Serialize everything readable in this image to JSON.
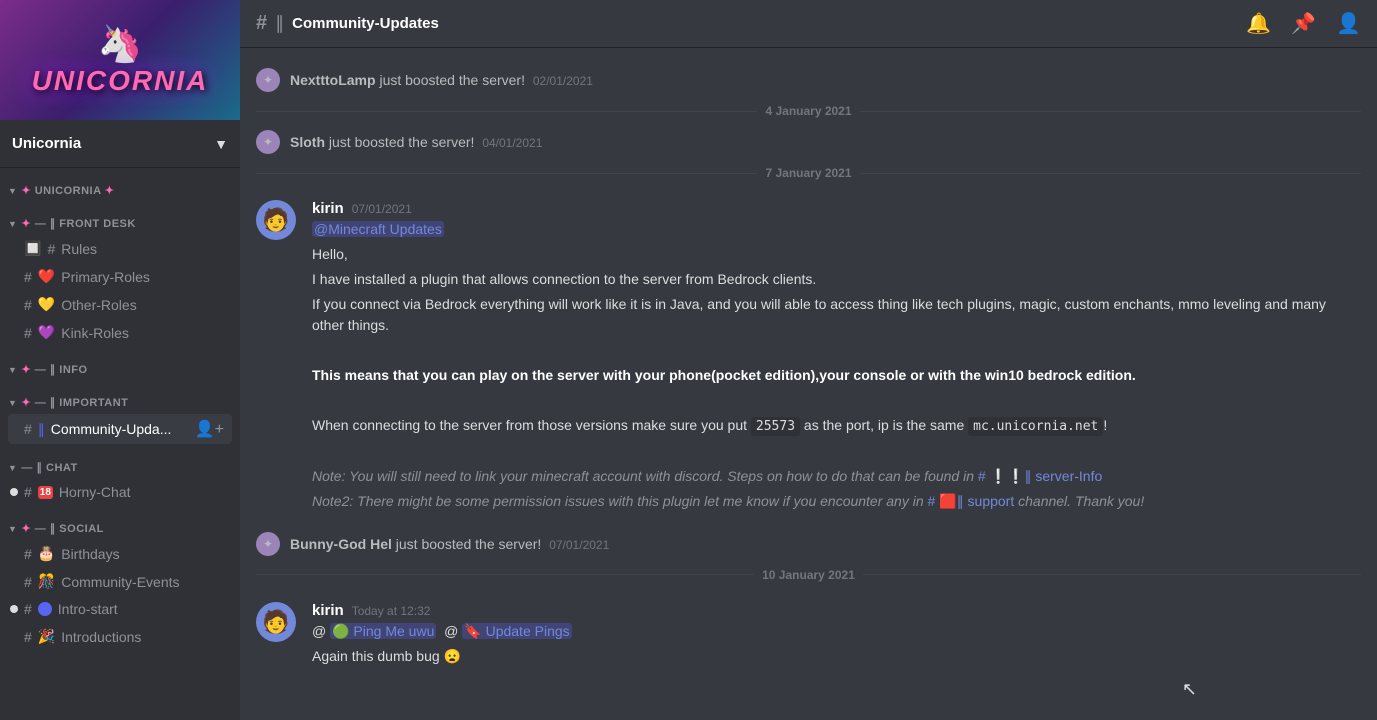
{
  "server": {
    "name": "Unicornia",
    "banner_text": "UNICORNIA",
    "dropdown_arrow": "▼"
  },
  "categories": [
    {
      "id": "unicornia",
      "label": "✦ UNICORNIA ✦",
      "channels": []
    },
    {
      "id": "front-desk",
      "label": "✦ — ∥ FRONT DESK",
      "channels": [
        {
          "id": "rules",
          "name": "Rules",
          "icon": "#",
          "emoji": "🔲",
          "emoji_color": "#ed4245"
        },
        {
          "id": "primary-roles",
          "name": "Primary-Roles",
          "icon": "#",
          "emoji": "❤️"
        },
        {
          "id": "other-roles",
          "name": "Other-Roles",
          "icon": "#",
          "emoji": "💛"
        },
        {
          "id": "kink-roles",
          "name": "Kink-Roles",
          "icon": "#",
          "emoji": "💜"
        }
      ]
    },
    {
      "id": "info",
      "label": "✦ — ∥ INFO",
      "channels": []
    },
    {
      "id": "important",
      "label": "✦ — ∥ IMPORTANT",
      "channels": [
        {
          "id": "community-updates",
          "name": "Community-Upda...",
          "icon": "#",
          "emoji": "∥",
          "active": true,
          "has_add": true
        }
      ]
    },
    {
      "id": "chat",
      "label": "— ∥ CHAT",
      "channels": [
        {
          "id": "horny-chat",
          "name": "Horny-Chat",
          "icon": "#",
          "emoji": "🔞",
          "has_unread": true
        }
      ]
    },
    {
      "id": "social",
      "label": "✦ — ∥ SOCIAL",
      "channels": [
        {
          "id": "birthdays",
          "name": "Birthdays",
          "icon": "#",
          "emoji": "🎂"
        },
        {
          "id": "community-events",
          "name": "Community-Events",
          "icon": "#",
          "emoji": "🎊"
        },
        {
          "id": "intro-start",
          "name": "Intro-start",
          "icon": "#",
          "emoji": "🔵",
          "has_unread": true
        },
        {
          "id": "introductions",
          "name": "Introductions",
          "icon": "#",
          "emoji": "🎉"
        }
      ]
    }
  ],
  "channel": {
    "name": "Community-Updates",
    "icon": "∥",
    "hash": "#"
  },
  "header_icons": {
    "bell": "🔔",
    "pin": "📌",
    "members": "👤"
  },
  "messages": [
    {
      "type": "boost",
      "user": "NextttoLamp",
      "text": "just boosted the server!",
      "date": "02/01/2021"
    },
    {
      "type": "date_divider",
      "label": "4 January 2021"
    },
    {
      "type": "boost",
      "user": "Sloth",
      "text": "just boosted the server!",
      "date": "04/01/2021"
    },
    {
      "type": "date_divider",
      "label": "7 January 2021"
    },
    {
      "type": "message",
      "id": "msg1",
      "author": "kirin",
      "timestamp": "07/01/2021",
      "avatar_color": "#5865f2",
      "avatar_emoji": "🧑",
      "lines": [
        {
          "type": "mention",
          "text": "@Minecraft Updates"
        },
        {
          "type": "plain",
          "text": "Hello,"
        },
        {
          "type": "plain",
          "text": "I have installed a plugin that allows connection to the server from Bedrock clients."
        },
        {
          "type": "plain",
          "text": "If you connect via Bedrock everything will work like it is in Java, and you will able to access thing like tech plugins, magic, custom enchants, mmo leveling and many other things."
        },
        {
          "type": "bold",
          "text": "This means that you can play on the server with your phone(pocket edition),your console or with the win10 bedrock edition."
        },
        {
          "type": "plain",
          "text": "When connecting to the server from those versions make sure you put "
        },
        {
          "type": "port_info",
          "port": "25573",
          "suffix": " as the port, ip is the same ",
          "code": "mc.unicornia.net",
          "end": "!"
        },
        {
          "type": "italic_note",
          "text": "Note: You will still need to link your minecraft account with discord. Steps on how to do that can be found in # ❕❕∥ server-Info"
        },
        {
          "type": "italic_note2",
          "text": "Note2: There might be some permission issues with this plugin let me know if you encounter any in # 🟥∥ support channel. Thank you!"
        }
      ]
    },
    {
      "type": "boost",
      "user": "Bunny-God Hel",
      "text": "just boosted the server!",
      "date": "07/01/2021"
    },
    {
      "type": "date_divider",
      "label": "10 January 2021"
    },
    {
      "type": "message",
      "id": "msg2",
      "author": "kirin",
      "timestamp": "Today at 12:32",
      "avatar_color": "#5865f2",
      "avatar_emoji": "🧑",
      "lines": [
        {
          "type": "ping_line",
          "at1": "🟢 Ping Me uwu",
          "at2": "🔖 Update Pings"
        },
        {
          "type": "plain",
          "text": "Again this dumb bug 😦"
        }
      ]
    }
  ]
}
